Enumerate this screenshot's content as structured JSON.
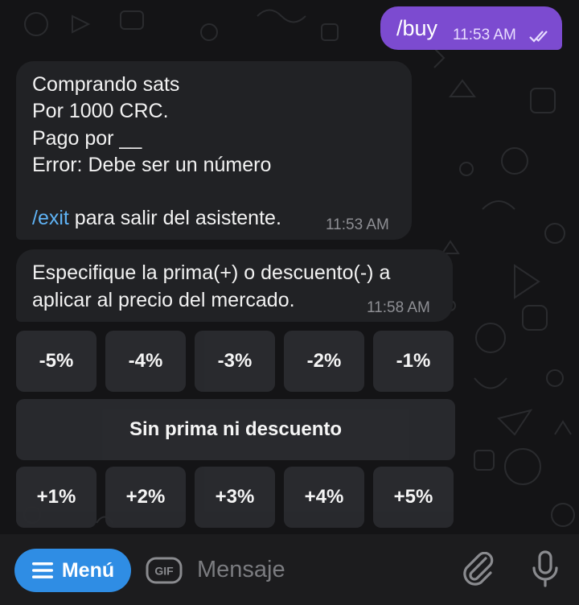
{
  "chat": {
    "outgoing": {
      "text": "/buy",
      "time": "11:53 AM"
    },
    "message1": {
      "lines": [
        "Comprando sats",
        "Por 1000 CRC.",
        "Pago por __",
        "Error: Debe ser un número"
      ],
      "link": "/exit",
      "link_suffix": " para salir del asistente.",
      "time": "11:53 AM"
    },
    "message2": {
      "lines": [
        "Especifique la prima(+) o descuento(-) a",
        "aplicar al precio del mercado."
      ],
      "time": "11:58 AM"
    }
  },
  "keyboard": {
    "row1": [
      "-5%",
      "-4%",
      "-3%",
      "-2%",
      "-1%"
    ],
    "row2": [
      "Sin prima ni descuento"
    ],
    "row3": [
      "+1%",
      "+2%",
      "+3%",
      "+4%",
      "+5%"
    ]
  },
  "input_bar": {
    "menu_label": "Menú",
    "gif_label": "GIF",
    "placeholder": "Mensaje"
  },
  "colors": {
    "outgoing_bubble": "#7c4bd0",
    "incoming_bubble": "#212225",
    "link": "#5fb3f5",
    "menu_button": "#2f8de4"
  },
  "icons": [
    "double-check-icon",
    "hamburger-icon",
    "gif-icon",
    "paperclip-icon",
    "microphone-icon"
  ]
}
